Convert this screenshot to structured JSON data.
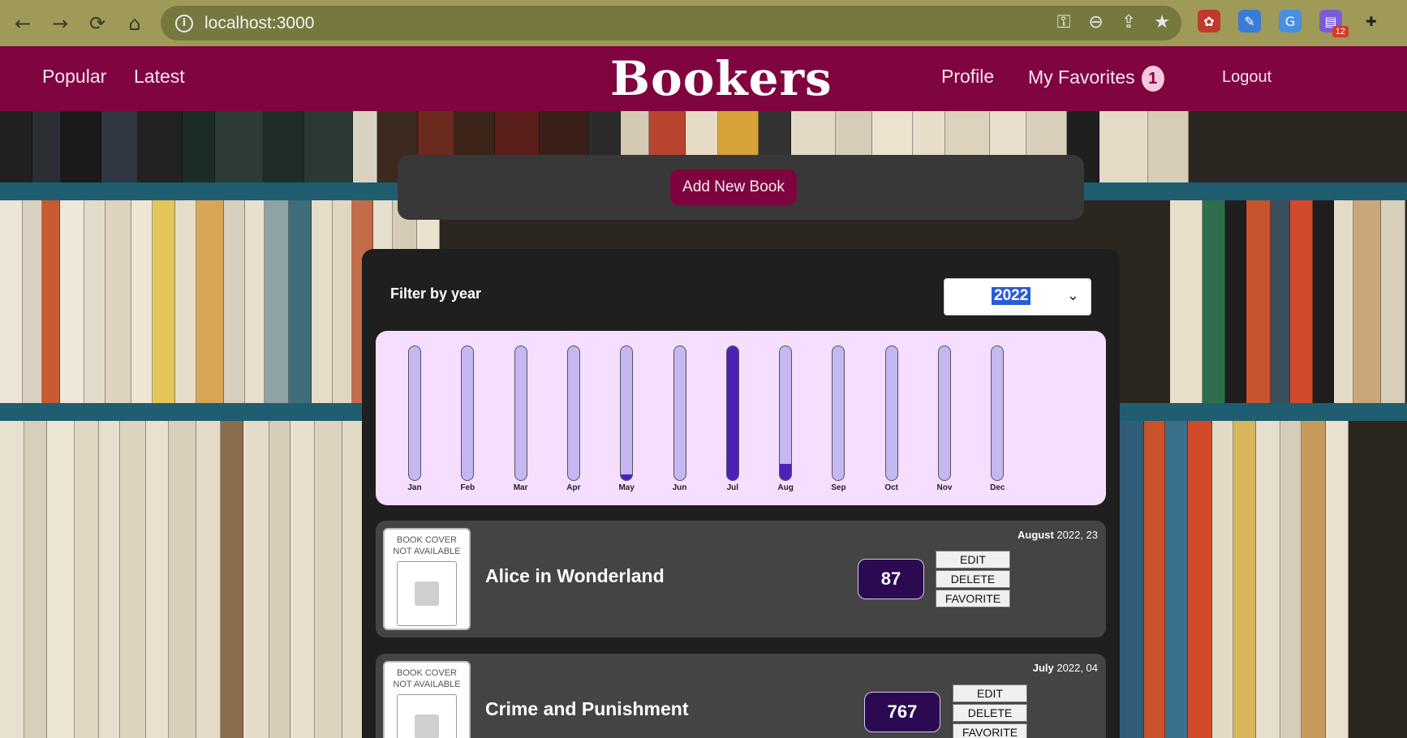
{
  "browser": {
    "url": "localhost:3000",
    "extensions_badge": "12"
  },
  "header": {
    "brand": "Bookers",
    "nav_left": [
      "Popular",
      "Latest"
    ],
    "profile": "Profile",
    "favorites": "My Favorites",
    "favorites_count": "1",
    "logout": "Logout"
  },
  "add_panel": {
    "button": "Add New Book"
  },
  "filter": {
    "label": "Filter by year",
    "selected_year": "2022",
    "chevron": "⌄"
  },
  "chart_data": {
    "type": "bar",
    "categories": [
      "Jan",
      "Feb",
      "Mar",
      "Apr",
      "May",
      "Jun",
      "Jul",
      "Aug",
      "Sep",
      "Oct",
      "Nov",
      "Dec"
    ],
    "values": [
      0,
      0,
      0,
      0,
      4,
      0,
      100,
      12,
      0,
      0,
      0,
      0
    ],
    "ylim": [
      0,
      100
    ],
    "colors": {
      "track": "#c4b7f2",
      "fill": "#4b22b8",
      "background": "#f5deff"
    }
  },
  "books": [
    {
      "title": "Alice in Wonderland",
      "date_month": "August",
      "date_rest": " 2022, 23",
      "score": "87",
      "cover_text_1": "BOOK COVER",
      "cover_text_2": "NOT AVAILABLE",
      "edit": "EDIT",
      "delete": "DELETE",
      "favorite": "FAVORITE"
    },
    {
      "title": "Crime and Punishment",
      "date_month": "July",
      "date_rest": " 2022, 04",
      "score": "767",
      "cover_text_1": "BOOK COVER",
      "cover_text_2": "NOT AVAILABLE",
      "edit": "EDIT",
      "delete": "DELETE",
      "favorite": "FAVORITE"
    }
  ],
  "colors": {
    "header": "#800440",
    "accent": "#7e0440",
    "panel": "#383838",
    "card": "#444444"
  }
}
